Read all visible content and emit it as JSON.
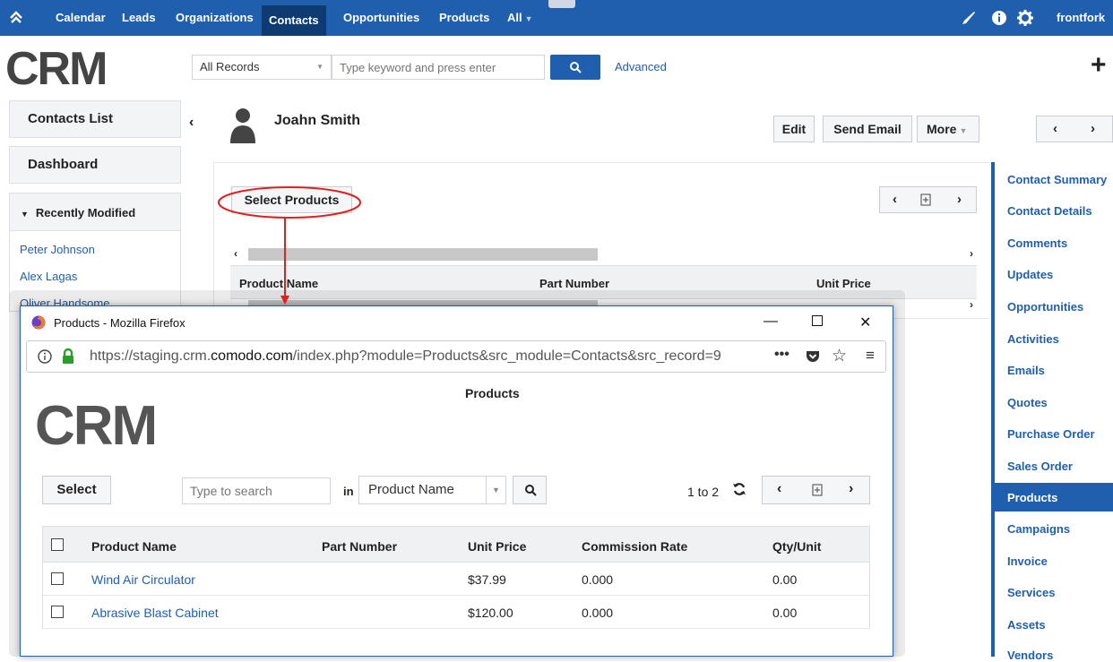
{
  "topnav": {
    "items": [
      "Calendar",
      "Leads",
      "Organizations",
      "Contacts",
      "Opportunities",
      "Products",
      "All"
    ],
    "user": "frontfork"
  },
  "header": {
    "logo": "CRM",
    "records_select": "All Records",
    "search_placeholder": "Type keyword and press enter",
    "advanced": "Advanced"
  },
  "sidebar": {
    "contacts_list": "Contacts List",
    "dashboard": "Dashboard",
    "recently_modified": "Recently Modified",
    "recent": [
      "Peter Johnson",
      "Alex Lagas",
      "Oliver Handsome"
    ]
  },
  "record": {
    "name": "Joahn Smith",
    "edit": "Edit",
    "send_email": "Send Email",
    "more": "More"
  },
  "main": {
    "select_products": "Select Products",
    "columns": [
      "Product Name",
      "Part Number",
      "Unit Price"
    ]
  },
  "related_menu": {
    "items": [
      "Contact Summary",
      "Contact Details",
      "Comments",
      "Updates",
      "Opportunities",
      "Activities",
      "Emails",
      "Quotes",
      "Purchase Order",
      "Sales Order",
      "Products",
      "Campaigns",
      "Invoice",
      "Services",
      "Assets",
      "Vendors"
    ],
    "active": "Products"
  },
  "popup": {
    "window_title": "Products - Mozilla Firefox",
    "url_pre": "https://staging.crm.",
    "url_domain": "comodo.com",
    "url_post": "/index.php?module=Products&src_module=Contacts&src_record=9",
    "heading": "Products",
    "logo": "CRM",
    "select": "Select",
    "search_placeholder": "Type to search",
    "in_label": "in",
    "field_select": "Product Name",
    "count": "1 to 2",
    "columns": [
      "Product Name",
      "Part Number",
      "Unit Price",
      "Commission Rate",
      "Qty/Unit"
    ],
    "rows": [
      {
        "name": "Wind Air Circulator",
        "part": "",
        "price": "$37.99",
        "commission": "0.000",
        "qty": "0.00"
      },
      {
        "name": "Abrasive Blast Cabinet",
        "part": "",
        "price": "$120.00",
        "commission": "0.000",
        "qty": "0.00"
      }
    ]
  },
  "colors": {
    "brand": "#1f5fae",
    "nav_active": "#0d3b72",
    "annotation": "#e0201f"
  }
}
